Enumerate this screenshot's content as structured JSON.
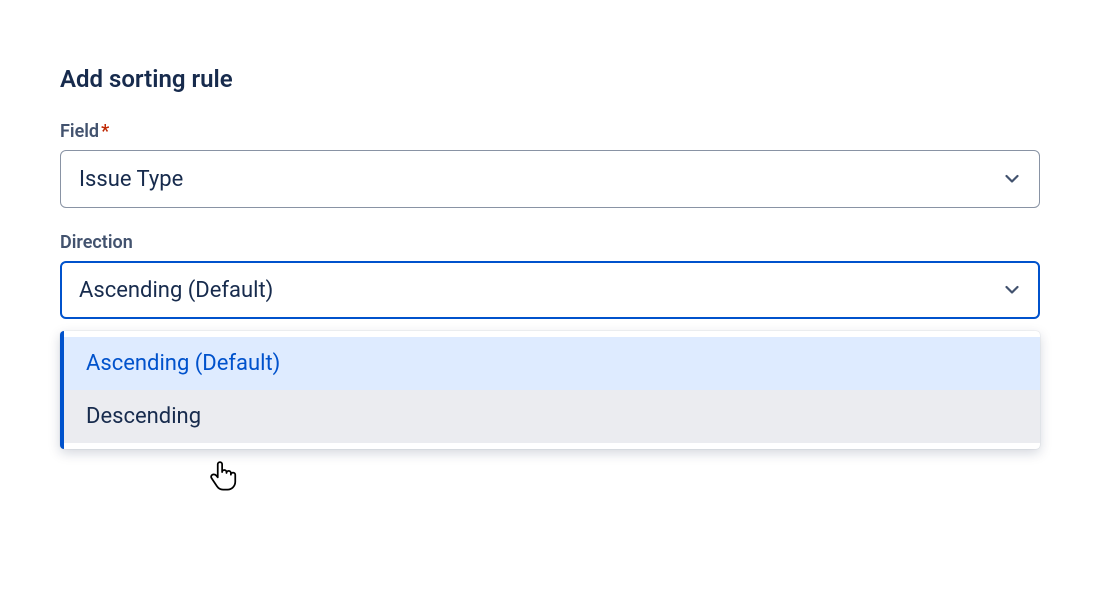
{
  "heading": "Add sorting rule",
  "field": {
    "label": "Field",
    "required_mark": "*",
    "value": "Issue Type"
  },
  "direction": {
    "label": "Direction",
    "value": "Ascending (Default)",
    "options": {
      "ascending": "Ascending (Default)",
      "descending": "Descending"
    }
  }
}
